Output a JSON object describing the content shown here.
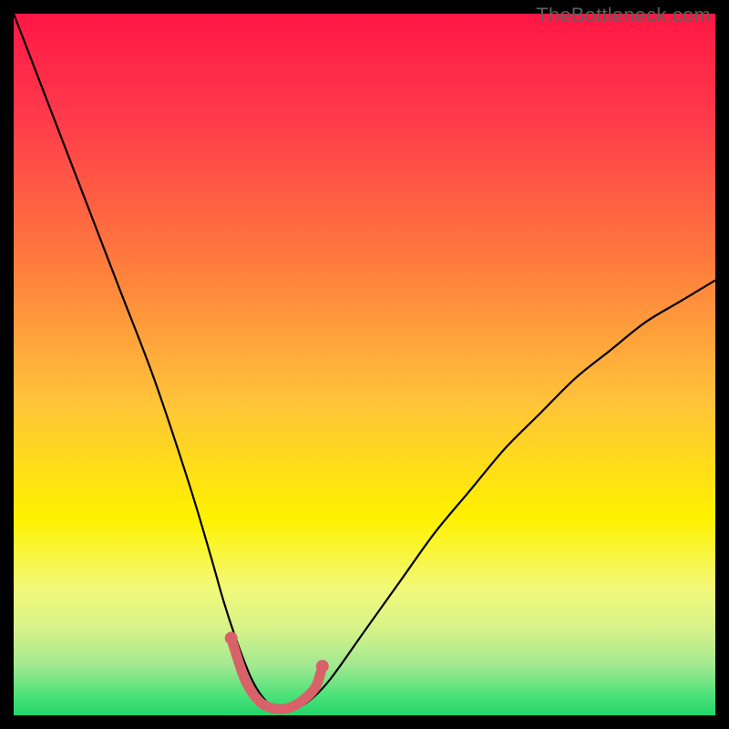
{
  "watermark": "TheBottleneck.com",
  "chart_data": {
    "type": "line",
    "title": "",
    "xlabel": "",
    "ylabel": "",
    "xlim": [
      0,
      100
    ],
    "ylim": [
      0,
      100
    ],
    "series": [
      {
        "name": "bottleneck-curve",
        "x": [
          0,
          5,
          10,
          15,
          20,
          25,
          28,
          30,
          32,
          34,
          36,
          38,
          40,
          42,
          45,
          50,
          55,
          60,
          65,
          70,
          75,
          80,
          85,
          90,
          95,
          100
        ],
        "values": [
          100,
          87,
          74,
          61,
          48,
          33,
          23,
          16,
          10,
          5,
          2,
          1,
          1,
          2,
          5,
          12,
          19,
          26,
          32,
          38,
          43,
          48,
          52,
          56,
          59,
          62
        ]
      },
      {
        "name": "optimal-zone",
        "x": [
          31,
          33,
          35,
          37,
          39,
          41,
          43,
          44
        ],
        "values": [
          11,
          5,
          2,
          1,
          1,
          2,
          4,
          7
        ]
      }
    ],
    "gradient_stops": [
      {
        "offset": 0.0,
        "color": "#ff1744"
      },
      {
        "offset": 0.15,
        "color": "#ff3b4b"
      },
      {
        "offset": 0.35,
        "color": "#ff7a3d"
      },
      {
        "offset": 0.55,
        "color": "#ffc23a"
      },
      {
        "offset": 0.72,
        "color": "#fff200"
      },
      {
        "offset": 0.82,
        "color": "#f2f97a"
      },
      {
        "offset": 0.88,
        "color": "#d4f28a"
      },
      {
        "offset": 0.93,
        "color": "#a0e890"
      },
      {
        "offset": 0.97,
        "color": "#4fe27a"
      },
      {
        "offset": 1.0,
        "color": "#22d56a"
      }
    ],
    "annotations": []
  }
}
